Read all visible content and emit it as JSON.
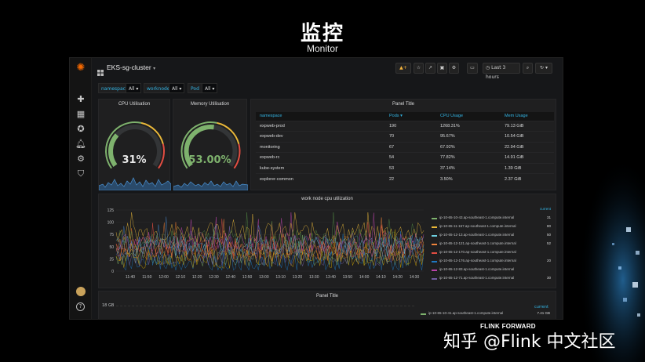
{
  "slide": {
    "title": "监控",
    "subtitle": "Monitor"
  },
  "topbar": {
    "dashboard_title": "EKS-sg-cluster",
    "time_range": "Last 3 hours"
  },
  "variables": [
    {
      "label": "namespace",
      "value": "All"
    },
    {
      "label": "worknode",
      "value": "All"
    },
    {
      "label": "Pod",
      "value": "All"
    }
  ],
  "gauges": [
    {
      "title": "CPU Utilisation",
      "value": "31%",
      "percent": 31
    },
    {
      "title": "Memory Utilisation",
      "value": "53.00%",
      "percent": 53
    }
  ],
  "table": {
    "title": "Panel Title",
    "columns": [
      "namespace",
      "Pods ▾",
      "CPU Usage",
      "Mem Usage"
    ],
    "rows": [
      [
        "expweb-prod",
        "190",
        "1268.31%",
        "79.13 GiB"
      ],
      [
        "expweb-dev",
        "70",
        "95.67%",
        "10.54 GiB"
      ],
      [
        "monitoring",
        "67",
        "67.92%",
        "22.94 GiB"
      ],
      [
        "expweb-rc",
        "54",
        "77.82%",
        "14.91 GiB"
      ],
      [
        "kube-system",
        "53",
        "37.14%",
        "1.39 GiB"
      ],
      [
        "explorer-common",
        "22",
        "3.50%",
        "2.37 GiB"
      ]
    ]
  },
  "cpu_chart": {
    "title": "work node cpu utilization",
    "legend_header": "current",
    "y_ticks": [
      "125",
      "100",
      "75",
      "50",
      "25",
      "0"
    ],
    "x_ticks": [
      "11:40",
      "11:50",
      "12:00",
      "12:10",
      "12:20",
      "12:30",
      "12:40",
      "12:50",
      "13:00",
      "13:10",
      "13:20",
      "13:30",
      "13:40",
      "13:50",
      "14:00",
      "14:10",
      "14:20",
      "14:30"
    ],
    "legend": [
      {
        "name": "ip-10-65-10-43.ap-southeast-1.compute.internal",
        "value": "31",
        "color": "#7eb26d"
      },
      {
        "name": "ip-10-65-11-167.ap-southeast-1.compute.internal",
        "value": "80",
        "color": "#eab839"
      },
      {
        "name": "ip-10-65-12-13.ap-southeast-1.compute.internal",
        "value": "50",
        "color": "#6ed0e0"
      },
      {
        "name": "ip-10-65-12-121.ap-southeast-1.compute.internal",
        "value": "52",
        "color": "#ef843c"
      },
      {
        "name": "ip-10-65-12-170.ap-southeast-1.compute.internal",
        "value": "",
        "color": "#e24d42"
      },
      {
        "name": "ip-10-65-12-176.ap-southeast-1.compute.internal",
        "value": "20",
        "color": "#1f78c1"
      },
      {
        "name": "ip-10-65-12-83.ap-southeast-1.compute.internal",
        "value": "",
        "color": "#ba43a9"
      },
      {
        "name": "ip-10-65-12-71.ap-southeast-1.compute.internal",
        "value": "30",
        "color": "#705da0"
      }
    ]
  },
  "bottom_panel": {
    "title": "Panel Title",
    "y_tick": "18 GB",
    "legend_header": "current",
    "legend": [
      {
        "name": "ip-10-65-10-41.ap-southeast-1.compute.internal",
        "value": "7.41 GB",
        "color": "#7eb26d"
      }
    ]
  },
  "watermark": {
    "text": "知乎 @Flink 中文社区",
    "brand": "FLINK FORWARD"
  }
}
